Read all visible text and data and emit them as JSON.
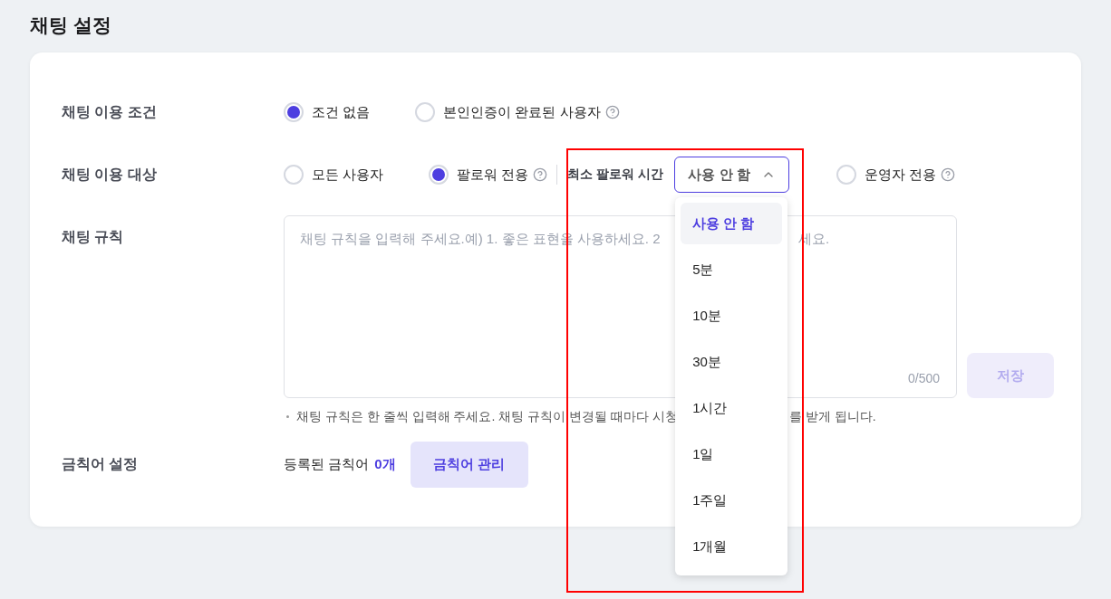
{
  "title": "채팅 설정",
  "condition": {
    "label": "채팅 이용 조건",
    "options": [
      {
        "label": "조건 없음",
        "selected": true,
        "help": false
      },
      {
        "label": "본인인증이 완료된 사용자",
        "selected": false,
        "help": true
      }
    ]
  },
  "audience": {
    "label": "채팅 이용 대상",
    "options": [
      {
        "label": "모든 사용자",
        "selected": false,
        "help": false
      },
      {
        "label": "팔로워 전용",
        "selected": true,
        "help": true
      },
      {
        "label": "운영자 전용",
        "selected": false,
        "help": true
      }
    ],
    "min_follow": {
      "label": "최소 팔로워 시간",
      "value": "사용 안 함",
      "expanded": true,
      "options": [
        {
          "label": "사용 안 함",
          "selected": true
        },
        {
          "label": "5분",
          "selected": false
        },
        {
          "label": "10분",
          "selected": false
        },
        {
          "label": "30분",
          "selected": false
        },
        {
          "label": "1시간",
          "selected": false
        },
        {
          "label": "1일",
          "selected": false
        },
        {
          "label": "1주일",
          "selected": false
        },
        {
          "label": "1개월",
          "selected": false
        }
      ]
    }
  },
  "rules": {
    "label": "채팅 규칙",
    "placeholder_parts": [
      "채팅 규칙을 입력해 주세요.예) 1. 좋은 표현을 사용하세요. 2",
      "세요."
    ],
    "counter": "0/500",
    "save_button": {
      "label": "저장",
      "disabled": true
    },
    "note_parts": [
      "채팅 규칙은 한 줄씩 입력해 주세요. 채팅 규칙이 변경될 때마다 시청",
      "를 받게 됩니다."
    ]
  },
  "banned_words": {
    "label": "금칙어 설정",
    "text": "등록된 금칙어",
    "count": "0개",
    "button": "금칙어 관리"
  },
  "annotation": {
    "kind": "rectangle",
    "color": "#ff0000"
  }
}
